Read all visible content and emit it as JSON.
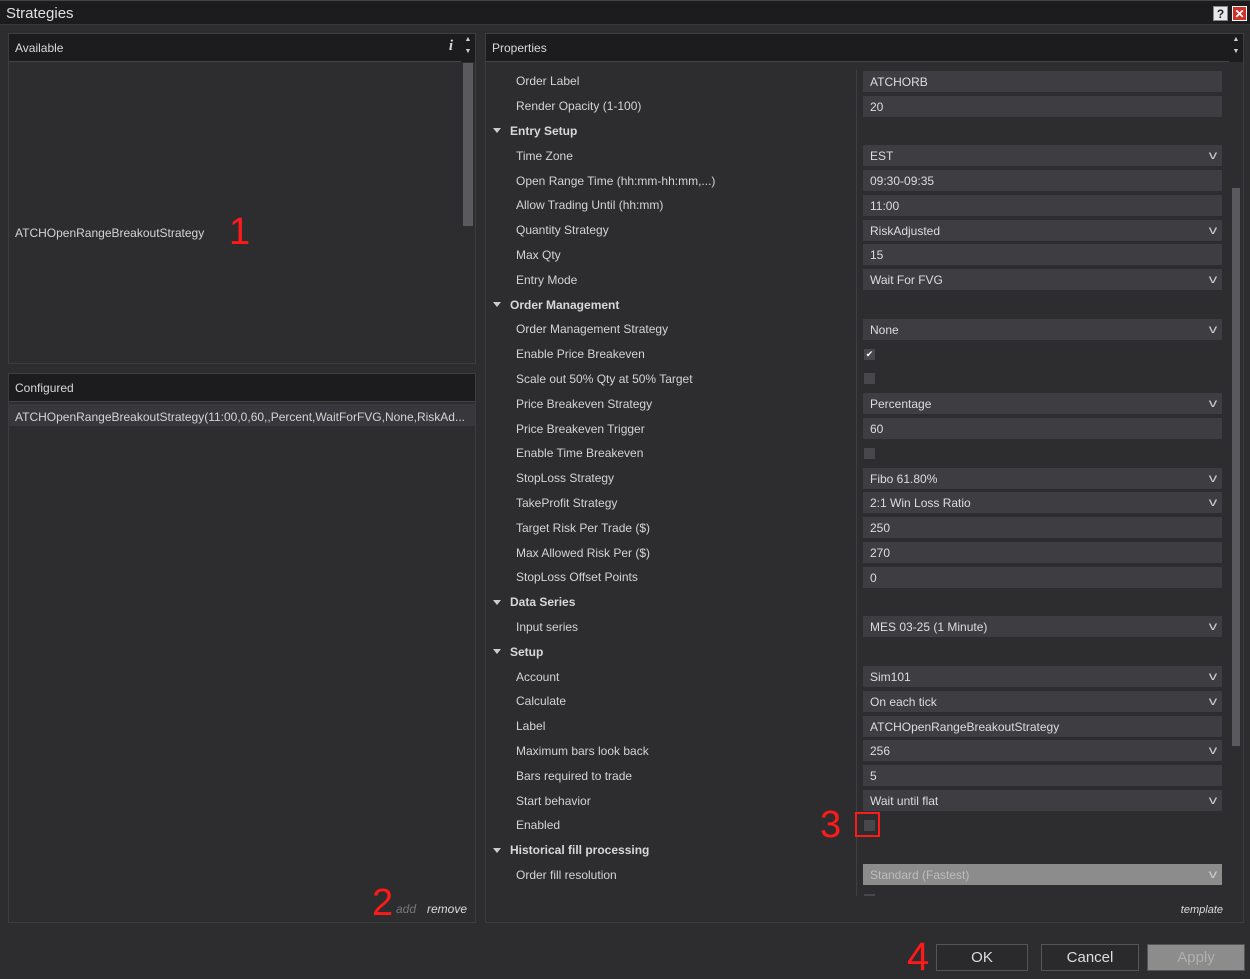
{
  "window": {
    "title": "Strategies",
    "help_label": "?",
    "close_label": "✕"
  },
  "available": {
    "header": "Available",
    "info_label": "i",
    "items": [
      "ATCHOpenRangeBreakoutStrategy"
    ]
  },
  "configured": {
    "header": "Configured",
    "items": [
      "ATCHOpenRangeBreakoutStrategy(11:00,0,60,,Percent,WaitForFVG,None,RiskAd..."
    ],
    "add_label": "add",
    "remove_label": "remove"
  },
  "properties": {
    "header": "Properties",
    "template_label": "template",
    "rows": [
      {
        "type": "text",
        "label": "Order Label",
        "value": "ATCHORB"
      },
      {
        "type": "text",
        "label": "Render Opacity (1-100)",
        "value": "20"
      },
      {
        "type": "cat",
        "label": "Entry Setup"
      },
      {
        "type": "select",
        "label": "Time Zone",
        "value": "EST"
      },
      {
        "type": "text",
        "label": "Open Range Time (hh:mm-hh:mm,...)",
        "value": "09:30-09:35"
      },
      {
        "type": "text",
        "label": "Allow Trading Until (hh:mm)",
        "value": "11:00"
      },
      {
        "type": "select",
        "label": "Quantity Strategy",
        "value": "RiskAdjusted"
      },
      {
        "type": "text",
        "label": "Max Qty",
        "value": "15"
      },
      {
        "type": "select",
        "label": "Entry Mode",
        "value": "Wait For FVG"
      },
      {
        "type": "cat",
        "label": "Order Management"
      },
      {
        "type": "select",
        "label": "Order Management Strategy",
        "value": "None"
      },
      {
        "type": "check",
        "label": "Enable Price Breakeven",
        "checked": true
      },
      {
        "type": "check",
        "label": "Scale out 50% Qty at 50% Target",
        "checked": false
      },
      {
        "type": "select",
        "label": "Price Breakeven Strategy",
        "value": "Percentage"
      },
      {
        "type": "text",
        "label": "Price Breakeven Trigger",
        "value": "60"
      },
      {
        "type": "check",
        "label": "Enable Time Breakeven",
        "checked": false
      },
      {
        "type": "select",
        "label": "StopLoss Strategy",
        "value": "Fibo 61.80%"
      },
      {
        "type": "select",
        "label": "TakeProfit Strategy",
        "value": "2:1 Win Loss Ratio"
      },
      {
        "type": "text",
        "label": "Target Risk Per Trade ($)",
        "value": "250"
      },
      {
        "type": "text",
        "label": "Max Allowed Risk Per ($)",
        "value": "270"
      },
      {
        "type": "text",
        "label": "StopLoss Offset Points",
        "value": "0"
      },
      {
        "type": "cat",
        "label": "Data Series"
      },
      {
        "type": "select",
        "label": "Input series",
        "value": "MES 03-25 (1 Minute)"
      },
      {
        "type": "cat",
        "label": "Setup"
      },
      {
        "type": "select",
        "label": "Account",
        "value": "Sim101"
      },
      {
        "type": "select",
        "label": "Calculate",
        "value": "On each tick"
      },
      {
        "type": "text",
        "label": "Label",
        "value": "ATCHOpenRangeBreakoutStrategy"
      },
      {
        "type": "select",
        "label": "Maximum bars look back",
        "value": "256"
      },
      {
        "type": "text",
        "label": "Bars required to trade",
        "value": "5"
      },
      {
        "type": "select",
        "label": "Start behavior",
        "value": "Wait until flat"
      },
      {
        "type": "check",
        "label": "Enabled",
        "checked": false,
        "highlight": true
      },
      {
        "type": "cat",
        "label": "Historical fill processing"
      },
      {
        "type": "select",
        "label": "Order fill resolution",
        "value": "Standard (Fastest)",
        "disabled": true
      },
      {
        "type": "check",
        "label": "",
        "checked": false
      }
    ]
  },
  "buttons": {
    "ok": "OK",
    "cancel": "Cancel",
    "apply": "Apply"
  },
  "annotations": [
    "1",
    "2",
    "3",
    "4"
  ],
  "colors": {
    "annotation": "#ff1a1a",
    "background": "#2d2d30",
    "header": "#1c1c1e"
  }
}
